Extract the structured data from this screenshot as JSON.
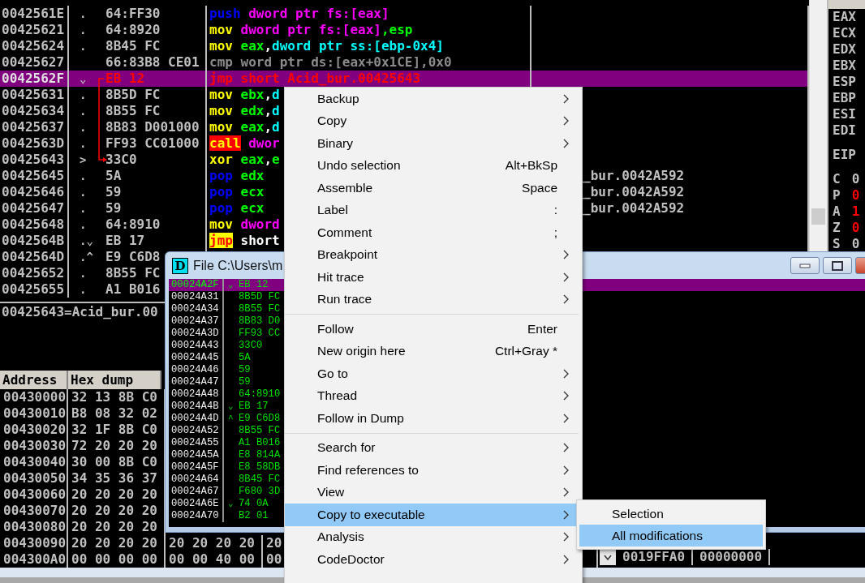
{
  "disassembly": {
    "rows": [
      {
        "address": "0042561E",
        "mark": ".",
        "hex": "64:FF30",
        "code": [
          {
            "text": "push ",
            "kind": "stack"
          },
          {
            "text": "dword ptr fs:[eax]",
            "kind": "mem"
          }
        ],
        "selected": false
      },
      {
        "address": "00425621",
        "mark": ".",
        "hex": "64:8920",
        "code": [
          {
            "text": "mov ",
            "kind": "move"
          },
          {
            "text": "dword ptr fs:[eax]",
            "kind": "mem"
          },
          {
            "text": ",esp",
            "kind": "reg"
          }
        ],
        "selected": false
      },
      {
        "address": "00425624",
        "mark": ".",
        "hex": "8B45 FC",
        "code": [
          {
            "text": "mov ",
            "kind": "move"
          },
          {
            "text": "eax",
            "kind": "reg"
          },
          {
            "text": ",",
            "kind": "plain"
          },
          {
            "text": "dword ptr ss:[ebp-0x4]",
            "kind": "memss"
          }
        ],
        "selected": false
      },
      {
        "address": "00425627",
        "mark": "",
        "hex": "66:83B8 CE01",
        "code": [
          {
            "text": "cmp word ptr ds:[eax+0x1CE],0x0",
            "kind": "dim"
          }
        ],
        "selected": false
      },
      {
        "address": "0042562F",
        "mark": "⌄",
        "hex": "EB 12",
        "code": [
          {
            "text": "jmp short Acid_bur.00425643",
            "kind": "jumpsel"
          }
        ],
        "selected": true
      },
      {
        "address": "00425631",
        "mark": ".",
        "hex": "8B5D FC",
        "code": [
          {
            "text": "mov ",
            "kind": "move"
          },
          {
            "text": "ebx",
            "kind": "reg"
          },
          {
            "text": ",",
            "kind": "plain"
          },
          {
            "text": "d",
            "kind": "memss"
          }
        ],
        "selected": false
      },
      {
        "address": "00425634",
        "mark": ".",
        "hex": "8B55 FC",
        "code": [
          {
            "text": "mov ",
            "kind": "move"
          },
          {
            "text": "edx",
            "kind": "reg"
          },
          {
            "text": ",",
            "kind": "plain"
          },
          {
            "text": "d",
            "kind": "memss"
          }
        ],
        "selected": false
      },
      {
        "address": "00425637",
        "mark": ".",
        "hex": "8B83 D001000",
        "code": [
          {
            "text": "mov ",
            "kind": "move"
          },
          {
            "text": "eax",
            "kind": "reg"
          },
          {
            "text": ",",
            "kind": "plain"
          },
          {
            "text": "d",
            "kind": "memss"
          }
        ],
        "selected": false
      },
      {
        "address": "0042563D",
        "mark": ".",
        "hex": "FF93 CC01000",
        "code": [
          {
            "text": "call",
            "kind": "call"
          },
          {
            "text": " dwor",
            "kind": "mem"
          }
        ],
        "selected": false
      },
      {
        "address": "00425643",
        "mark": ">",
        "hex": "33C0",
        "code": [
          {
            "text": "xor ",
            "kind": "move"
          },
          {
            "text": "eax",
            "kind": "reg"
          },
          {
            "text": ",",
            "kind": "plain"
          },
          {
            "text": "e",
            "kind": "reg"
          }
        ],
        "selected": false
      },
      {
        "address": "00425645",
        "mark": ".",
        "hex": "5A",
        "code": [
          {
            "text": "pop ",
            "kind": "stack"
          },
          {
            "text": "edx",
            "kind": "reg"
          }
        ],
        "comment": "_bur.0042A592",
        "selected": false
      },
      {
        "address": "00425646",
        "mark": ".",
        "hex": "59",
        "code": [
          {
            "text": "pop ",
            "kind": "stack"
          },
          {
            "text": "ecx",
            "kind": "reg"
          }
        ],
        "comment": "_bur.0042A592",
        "selected": false
      },
      {
        "address": "00425647",
        "mark": ".",
        "hex": "59",
        "code": [
          {
            "text": "pop ",
            "kind": "stack"
          },
          {
            "text": "ecx",
            "kind": "reg"
          }
        ],
        "comment": "_bur.0042A592",
        "selected": false
      },
      {
        "address": "00425648",
        "mark": ".",
        "hex": "64:8910",
        "code": [
          {
            "text": "mov ",
            "kind": "move"
          },
          {
            "text": "dword",
            "kind": "mem"
          }
        ],
        "selected": false
      },
      {
        "address": "0042564B",
        "mark": ".⌄",
        "hex": "EB 17",
        "code": [
          {
            "text": "jmp",
            "kind": "jmphl"
          },
          {
            "text": " short",
            "kind": "plain"
          }
        ],
        "selected": false
      },
      {
        "address": "0042564D",
        "mark": ".^",
        "hex": "E9 C6D8",
        "selected": false
      },
      {
        "address": "00425652",
        "mark": ".",
        "hex": "8B55 FC",
        "selected": false
      },
      {
        "address": "00425655",
        "mark": ".",
        "hex": "A1 B016",
        "selected": false
      }
    ]
  },
  "info_line": "00425643=Acid_bur.00",
  "dump": {
    "columns": [
      "Address",
      "Hex dump"
    ],
    "rows": [
      {
        "address": "00430000",
        "groups": [
          "32 13 8B C0"
        ]
      },
      {
        "address": "00430010",
        "groups": [
          "B8 08 32 02"
        ]
      },
      {
        "address": "00430020",
        "groups": [
          "32 1F 8B C0"
        ]
      },
      {
        "address": "00430030",
        "groups": [
          "72 20 20 20"
        ]
      },
      {
        "address": "00430040",
        "groups": [
          "30 00 8B C0"
        ]
      },
      {
        "address": "00430050",
        "groups": [
          "34 35 36 37"
        ]
      },
      {
        "address": "00430060",
        "groups": [
          "20 20 20 20"
        ]
      },
      {
        "address": "00430070",
        "groups": [
          "20 20 20 20"
        ]
      },
      {
        "address": "00430080",
        "groups": [
          "20 20 20 20"
        ]
      },
      {
        "address": "00430090",
        "groups": [
          "20 20 20 20",
          "20 20 20 20",
          "20"
        ]
      },
      {
        "address": "004300A0",
        "groups": [
          "00 00 00 00",
          "00 00 40 00",
          "00"
        ]
      }
    ]
  },
  "stack": {
    "values": [
      "0019FFA0",
      "00000000"
    ]
  },
  "registers": {
    "general": [
      "EAX",
      "ECX",
      "EDX",
      "EBX",
      "ESP",
      "EBP",
      "ESI",
      "EDI"
    ],
    "eip": "EIP",
    "flags": [
      {
        "name": "C",
        "value": "0",
        "changed": false
      },
      {
        "name": "P",
        "value": "0",
        "changed": true
      },
      {
        "name": "A",
        "value": "1",
        "changed": true
      },
      {
        "name": "Z",
        "value": "0",
        "changed": true
      },
      {
        "name": "S",
        "value": "0",
        "changed": false
      }
    ]
  },
  "file_window": {
    "icon_letter": "D",
    "title": "File C:\\Users\\m",
    "rows": [
      {
        "address": "00024A2F",
        "mark": "⌄",
        "hex": "EB 12",
        "selected": true
      },
      {
        "address": "00024A31",
        "mark": "",
        "hex": "8B5D FC",
        "selected": false
      },
      {
        "address": "00024A34",
        "mark": "",
        "hex": "8B55 FC",
        "selected": false
      },
      {
        "address": "00024A37",
        "mark": "",
        "hex": "8B83 D0",
        "selected": false
      },
      {
        "address": "00024A3D",
        "mark": "",
        "hex": "FF93 CC",
        "selected": false
      },
      {
        "address": "00024A43",
        "mark": "",
        "hex": "33C0",
        "selected": false
      },
      {
        "address": "00024A45",
        "mark": "",
        "hex": "5A",
        "selected": false
      },
      {
        "address": "00024A46",
        "mark": "",
        "hex": "59",
        "selected": false
      },
      {
        "address": "00024A47",
        "mark": "",
        "hex": "59",
        "selected": false
      },
      {
        "address": "00024A48",
        "mark": "",
        "hex": "64:8910",
        "selected": false
      },
      {
        "address": "00024A4B",
        "mark": "⌄",
        "hex": "EB 17",
        "selected": false
      },
      {
        "address": "00024A4D",
        "mark": "^",
        "hex": "E9 C6D8",
        "selected": false
      },
      {
        "address": "00024A52",
        "mark": "",
        "hex": "8B55 FC",
        "selected": false
      },
      {
        "address": "00024A55",
        "mark": "",
        "hex": "A1 B016",
        "selected": false
      },
      {
        "address": "00024A5A",
        "mark": "",
        "hex": "E8 814A",
        "selected": false
      },
      {
        "address": "00024A5F",
        "mark": "",
        "hex": "E8 58DB",
        "selected": false
      },
      {
        "address": "00024A64",
        "mark": "",
        "hex": "8B45 FC",
        "selected": false
      },
      {
        "address": "00024A67",
        "mark": "",
        "hex": "F680 3D",
        "selected": false
      },
      {
        "address": "00024A6E",
        "mark": "⌄",
        "hex": "74 0A",
        "selected": false
      },
      {
        "address": "00024A70",
        "mark": "",
        "hex": "B2 01",
        "selected": false
      }
    ]
  },
  "context_menu": {
    "items": [
      {
        "kind": "item",
        "label": "Backup",
        "submenu": true,
        "selected": false
      },
      {
        "kind": "item",
        "label": "Copy",
        "submenu": true,
        "selected": false
      },
      {
        "kind": "item",
        "label": "Binary",
        "submenu": true,
        "selected": false
      },
      {
        "kind": "item",
        "label": "Undo selection",
        "shortcut": "Alt+BkSp",
        "submenu": false,
        "selected": false
      },
      {
        "kind": "item",
        "label": "Assemble",
        "shortcut": "Space",
        "submenu": false,
        "selected": false
      },
      {
        "kind": "item",
        "label": "Label",
        "shortcut": ":",
        "submenu": false,
        "selected": false
      },
      {
        "kind": "item",
        "label": "Comment",
        "shortcut": ";",
        "submenu": false,
        "selected": false
      },
      {
        "kind": "item",
        "label": "Breakpoint",
        "submenu": true,
        "selected": false
      },
      {
        "kind": "item",
        "label": "Hit trace",
        "submenu": true,
        "selected": false
      },
      {
        "kind": "item",
        "label": "Run trace",
        "submenu": true,
        "selected": false
      },
      {
        "kind": "separator"
      },
      {
        "kind": "item",
        "label": "Follow",
        "shortcut": "Enter",
        "submenu": false,
        "selected": false
      },
      {
        "kind": "item",
        "label": "New origin here",
        "shortcut": "Ctrl+Gray *",
        "submenu": false,
        "selected": false
      },
      {
        "kind": "item",
        "label": "Go to",
        "submenu": true,
        "selected": false
      },
      {
        "kind": "item",
        "label": "Thread",
        "submenu": true,
        "selected": false
      },
      {
        "kind": "item",
        "label": "Follow in Dump",
        "submenu": true,
        "selected": false
      },
      {
        "kind": "separator"
      },
      {
        "kind": "item",
        "label": "Search for",
        "submenu": true,
        "selected": false
      },
      {
        "kind": "item",
        "label": "Find references to",
        "submenu": true,
        "selected": false
      },
      {
        "kind": "item",
        "label": "View",
        "submenu": true,
        "selected": false
      },
      {
        "kind": "item",
        "label": "Copy to executable",
        "submenu": true,
        "selected": true
      },
      {
        "kind": "item",
        "label": "Analysis",
        "submenu": true,
        "selected": false
      },
      {
        "kind": "item",
        "label": "CodeDoctor",
        "submenu": true,
        "selected": false
      }
    ]
  },
  "submenu": {
    "items": [
      {
        "label": "Selection",
        "selected": false
      },
      {
        "label": "All modifications",
        "selected": true
      }
    ]
  }
}
